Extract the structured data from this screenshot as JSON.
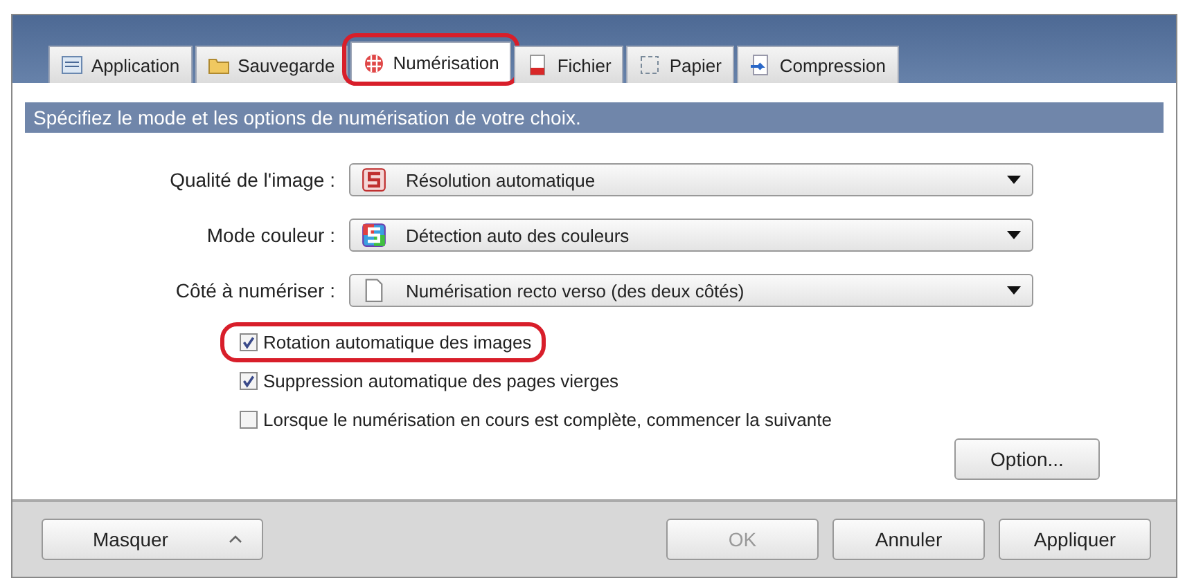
{
  "tabs": [
    {
      "label": "Application",
      "selected": false,
      "highlighted": false
    },
    {
      "label": "Sauvegarde",
      "selected": false,
      "highlighted": false
    },
    {
      "label": "Numérisation",
      "selected": true,
      "highlighted": true
    },
    {
      "label": "Fichier",
      "selected": false,
      "highlighted": false
    },
    {
      "label": "Papier",
      "selected": false,
      "highlighted": false
    },
    {
      "label": "Compression",
      "selected": false,
      "highlighted": false
    }
  ],
  "instruction": "Spécifiez le mode et les options de numérisation de votre choix.",
  "fields": [
    {
      "label": "Qualité de l'image :",
      "value": "Résolution automatique"
    },
    {
      "label": "Mode couleur :",
      "value": "Détection auto des couleurs"
    },
    {
      "label": "Côté à numériser :",
      "value": "Numérisation recto verso (des deux côtés)"
    }
  ],
  "checkboxes": [
    {
      "label": "Rotation automatique des images",
      "checked": true,
      "highlighted": true
    },
    {
      "label": "Suppression automatique des pages vierges",
      "checked": true,
      "highlighted": false
    },
    {
      "label": "Lorsque le numérisation en cours est complète, commencer la suivante",
      "checked": false,
      "highlighted": false
    }
  ],
  "option_button": "Option...",
  "footer": {
    "hide_button": "Masquer",
    "buttons": [
      {
        "label": "OK",
        "disabled": true
      },
      {
        "label": "Annuler",
        "disabled": false
      },
      {
        "label": "Appliquer",
        "disabled": false
      }
    ]
  }
}
